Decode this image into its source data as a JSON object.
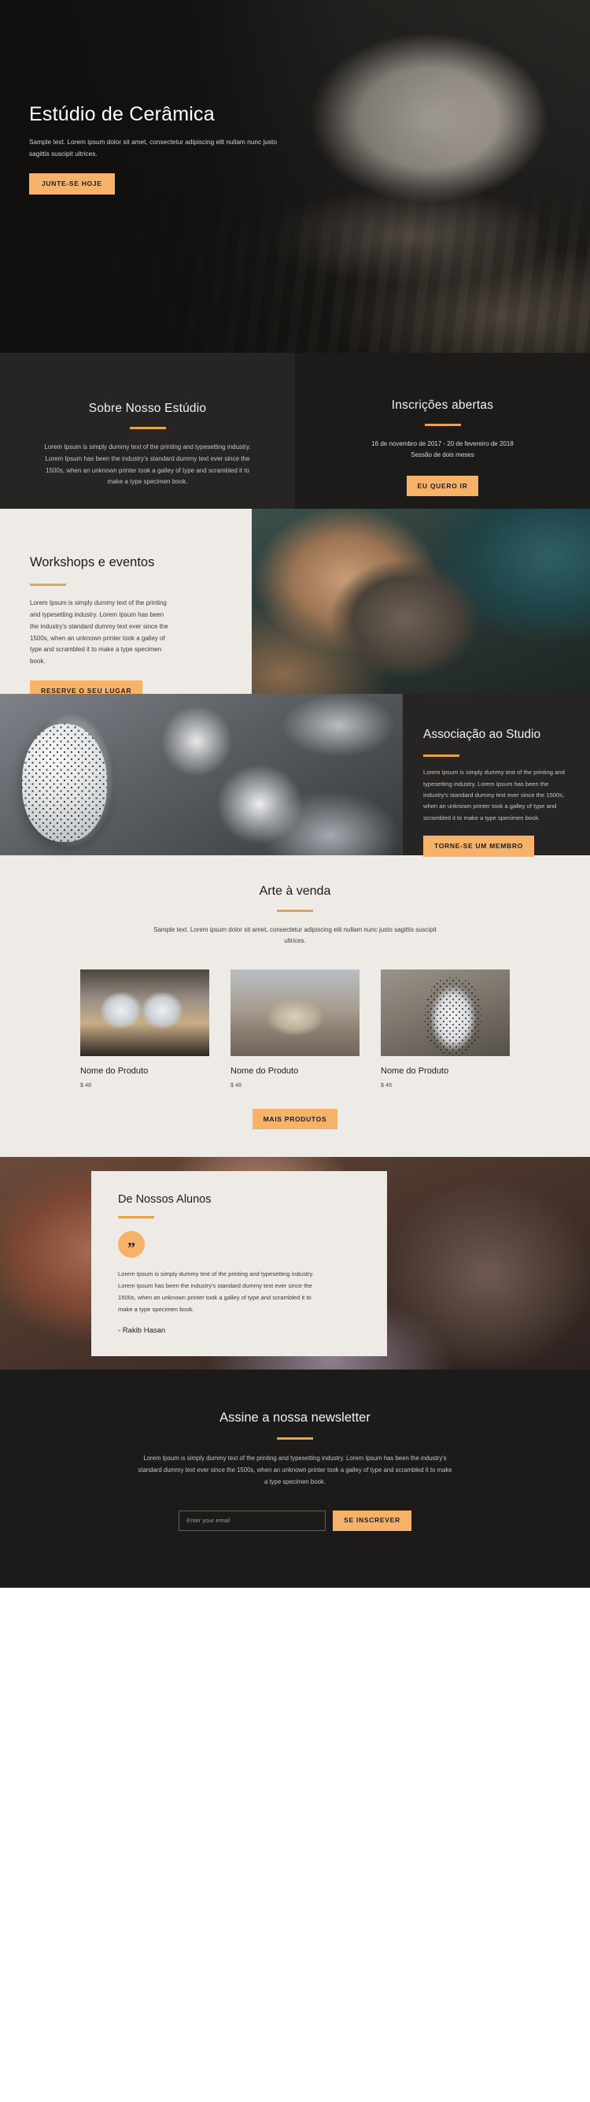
{
  "hero": {
    "title": "Estúdio de Cerâmica",
    "subtitle": "Sample text. Lorem ipsum dolor sit amet, consectetur adipiscing elit nullam nunc justo sagittis suscipit ultrices.",
    "cta": "JUNTE-SE HOJE"
  },
  "about": {
    "title": "Sobre Nosso Estúdio",
    "body": "Lorem Ipsum is simply dummy text of the printing and typesetting industry. Lorem Ipsum has been the industry's standard dummy text ever since the 1500s, when an unknown printer took a galley of type and scrambled it to make a type specimen book."
  },
  "enrollment": {
    "title": "Inscrições abertas",
    "dates": "16 de novembro de 2017 - 20 de fevereiro de 2018",
    "session": "Sessão de dois meses",
    "cta": "EU QUERO IR"
  },
  "workshops": {
    "title": "Workshops e eventos",
    "body": "Lorem Ipsum is simply dummy text of the printing and typesetting industry. Lorem Ipsum has been the industry's standard dummy text ever since the 1500s, when an unknown printer took a galley of type and scrambled it to make a type specimen book.",
    "cta": "RESERVE O SEU LUGAR"
  },
  "membership": {
    "title": "Associação ao Studio",
    "body": "Lorem Ipsum is simply dummy text of the printing and typesetting industry. Lorem Ipsum has been the industry's standard dummy text ever since the 1500s, when an unknown printer took a galley of type and scrambled it to make a type specimen book.",
    "cta": "TORNE-SE UM MEMBRO"
  },
  "shop": {
    "title": "Arte à venda",
    "lede": "Sample text. Lorem ipsum dolor sit amet, consectetur adipiscing elit nullam nunc justo sagittis suscipit ultrices.",
    "products": [
      {
        "name": "Nome do Produto",
        "price": "$ 48"
      },
      {
        "name": "Nome do Produto",
        "price": "$ 48"
      },
      {
        "name": "Nome do Produto",
        "price": "$ 48"
      }
    ],
    "cta": "MAIS PRODUTOS"
  },
  "testimonial": {
    "title": "De Nossos Alunos",
    "quote_glyph": "”",
    "body": "Lorem Ipsum is simply dummy text of the printing and typesetting industry. Lorem Ipsum has been the industry's standard dummy text ever since the 1500s, when an unknown printer took a galley of type and scrambled it to make a type specimen book.",
    "author": "- Rakib Hasan"
  },
  "newsletter": {
    "title": "Assine a nossa newsletter",
    "body": "Lorem Ipsum is simply dummy text of the printing and typesetting industry. Lorem Ipsum has been the industry's standard dummy text ever since the 1500s, when an unknown printer took a galley of type and scrambled it to make a type specimen book.",
    "email_placeholder": "Enter your email",
    "email_value": "",
    "cta": "SE INSCREVER"
  },
  "colors": {
    "accent": "#f7b26a",
    "rule": "#e8a24e",
    "dark_bg": "#1c1b1a",
    "dark_panel": "#262523",
    "light_bg": "#eeeae5"
  }
}
